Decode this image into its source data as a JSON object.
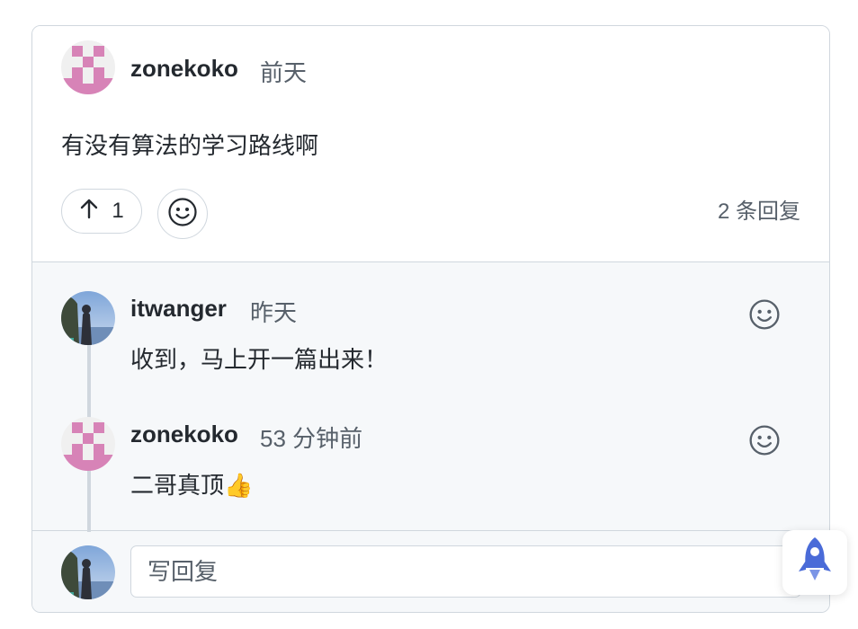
{
  "comment": {
    "author": "zonekoko",
    "time": "前天",
    "text": "有没有算法的学习路线啊",
    "upvote_icon": "arrow-up-icon",
    "upvote_count": "1",
    "reaction_icon": "smiley-icon",
    "reply_count_label": "2 条回复"
  },
  "replies": [
    {
      "author": "itwanger",
      "time": "昨天",
      "text": "收到，马上开一篇出来！",
      "reaction_icon": "smiley-icon"
    },
    {
      "author": "zonekoko",
      "time": "53 分钟前",
      "text": "二哥真顶👍",
      "reaction_icon": "smiley-icon"
    }
  ],
  "reply_box": {
    "placeholder": "写回复"
  },
  "floating": {
    "icon": "rocket-icon"
  },
  "colors": {
    "identicon": "#d783b7",
    "accent": "#4a6bd8",
    "border": "#d0d7de",
    "muted_text": "#57606a"
  }
}
